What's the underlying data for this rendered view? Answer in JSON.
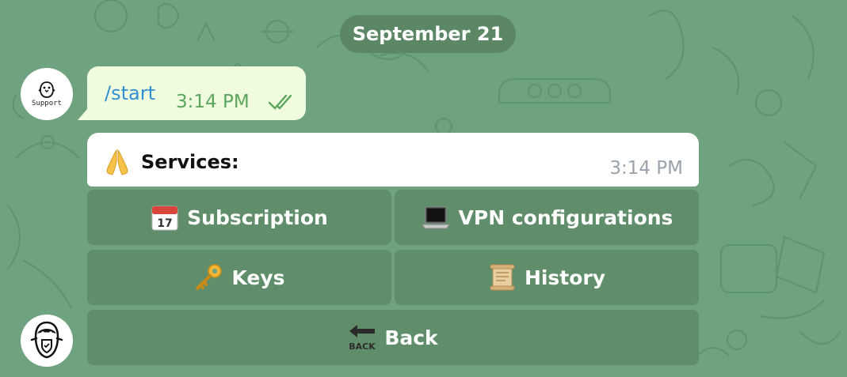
{
  "chat": {
    "date_separator": "September 21",
    "support_avatar_label": "Support"
  },
  "outgoing_message": {
    "text": "/start",
    "time": "3:14 PM",
    "status_icon": "double-check-icon"
  },
  "incoming_message": {
    "icon": "folded-hands-emoji",
    "text": "Services:",
    "time": "3:14 PM"
  },
  "keyboard": {
    "subscription": {
      "icon": "calendar-icon",
      "label": "Subscription"
    },
    "vpn": {
      "icon": "laptop-icon",
      "label": "VPN configurations"
    },
    "keys": {
      "icon": "key-icon",
      "label": "Keys"
    },
    "history": {
      "icon": "scroll-icon",
      "label": "History"
    },
    "back": {
      "icon": "back-arrow-icon",
      "label": "Back"
    }
  },
  "colors": {
    "background": "#6fa380",
    "outgoing_bubble": "#effdde",
    "link": "#2f8fd1",
    "outgoing_time": "#5aa65c",
    "incoming_time": "#9aa3ab"
  }
}
